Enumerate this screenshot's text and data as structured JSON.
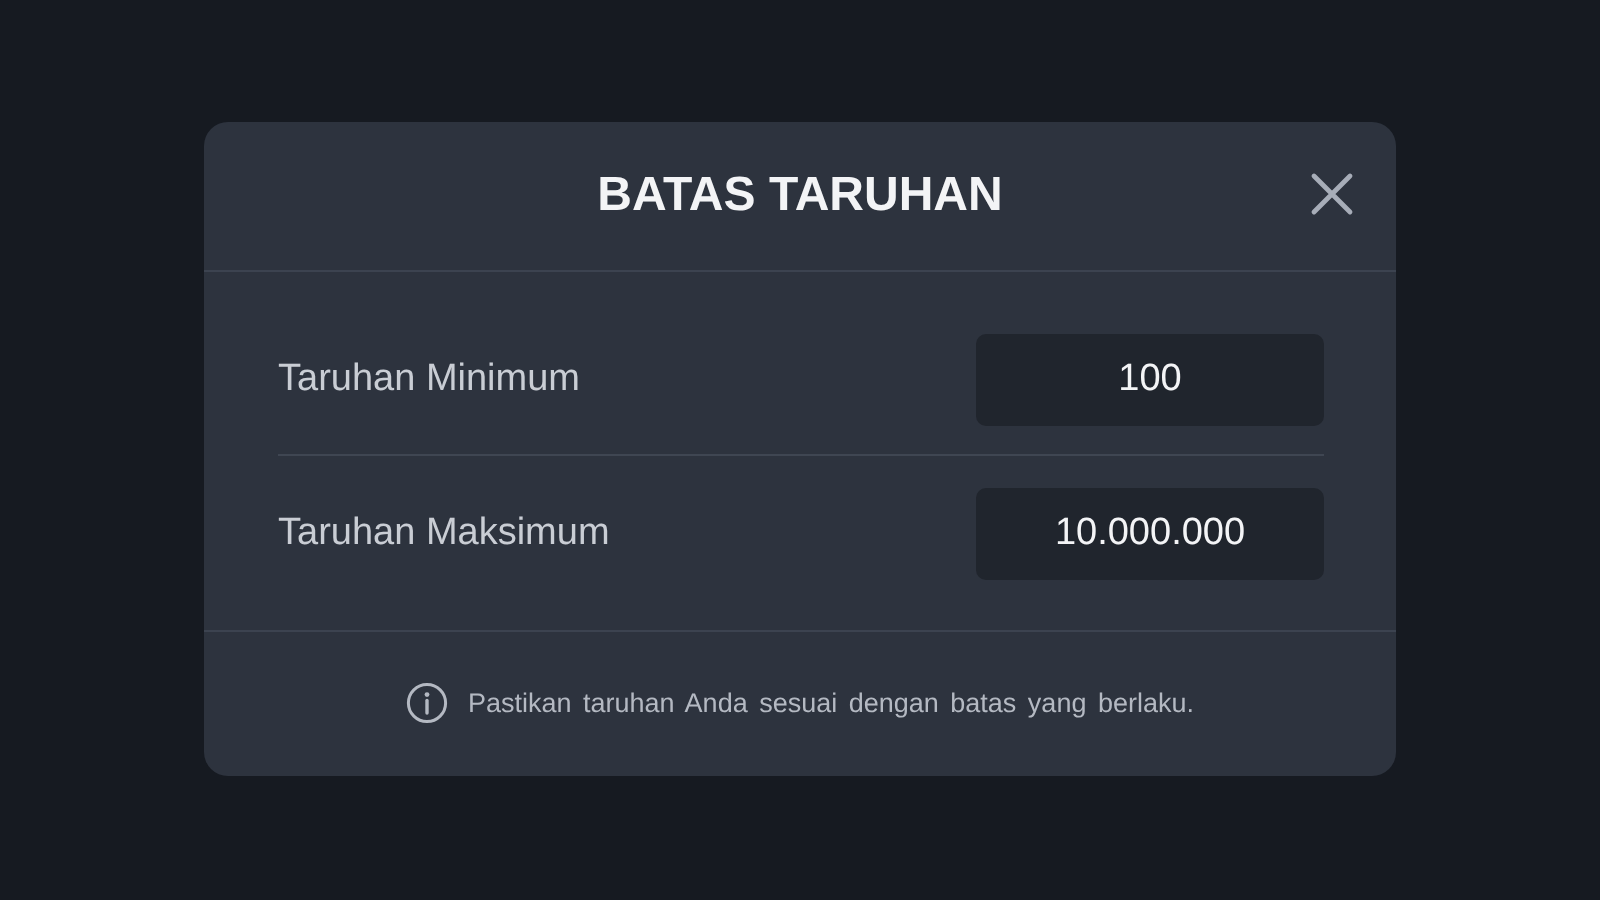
{
  "dialog": {
    "title": "BATAS TARUHAN",
    "rows": [
      {
        "label": "Taruhan Minimum",
        "value": "100"
      },
      {
        "label": "Taruhan Maksimum",
        "value": "10.000.000"
      }
    ],
    "note": "Pastikan taruhan Anda sesuai dengan batas yang berlaku."
  }
}
